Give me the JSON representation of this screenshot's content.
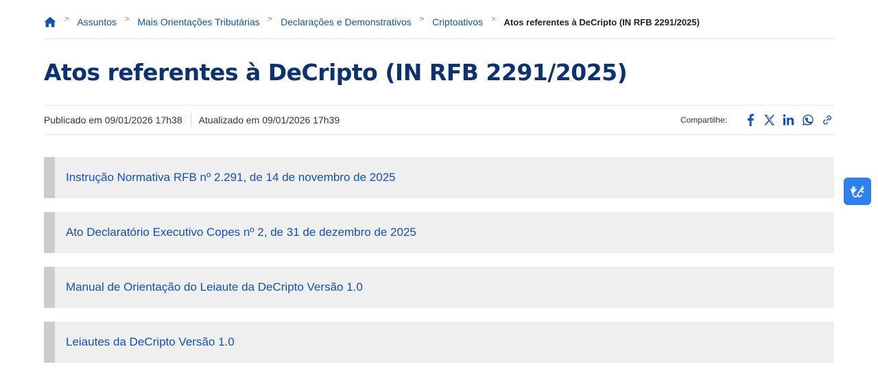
{
  "breadcrumb": {
    "home_icon": "home-icon",
    "items": [
      {
        "label": "Assuntos"
      },
      {
        "label": "Mais Orientações Tributárias"
      },
      {
        "label": "Declarações e Demonstrativos"
      },
      {
        "label": "Criptoativos"
      }
    ],
    "separator": ">",
    "current": "Atos referentes à DeCripto (IN RFB 2291/2025)"
  },
  "page": {
    "title": "Atos referentes à DeCripto (IN RFB 2291/2025)",
    "published": "Publicado em 09/01/2026 17h38",
    "updated": "Atualizado em 09/01/2026 17h39"
  },
  "share": {
    "label": "Compartilhe:",
    "icons": [
      "facebook-icon",
      "x-icon",
      "linkedin-icon",
      "whatsapp-icon",
      "link-icon"
    ]
  },
  "documents": [
    {
      "label": "Instrução Normativa RFB nº 2.291, de 14 de novembro de 2025"
    },
    {
      "label": "Ato Declaratório Executivo Copes nº 2, de 31 de dezembro de 2025"
    },
    {
      "label": "Manual de Orientação do Leiaute da DeCripto Versão 1.0"
    },
    {
      "label": "Leiautes da DeCripto Versão 1.0"
    }
  ],
  "colors": {
    "link": "#1351b4",
    "title": "#0c326f",
    "item_background": "#efefef",
    "item_border": "#cccccc",
    "accessibility_button": "#2f80ed"
  },
  "accessibility": {
    "icon": "sign-language-hands-icon"
  }
}
